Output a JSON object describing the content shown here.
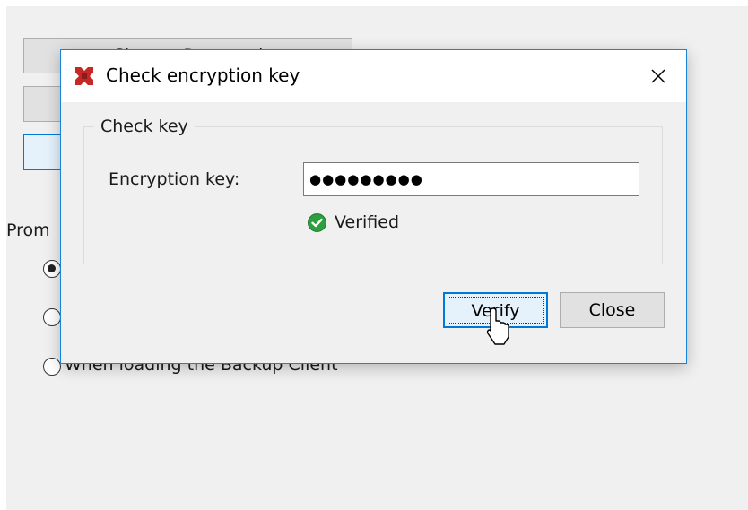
{
  "background": {
    "buttons": [
      "Change Password",
      "",
      ""
    ],
    "prompt_label": "Prom",
    "radio_options": [
      "",
      "",
      "When loading the Backup Client"
    ]
  },
  "dialog": {
    "title": "Check encryption key",
    "app_icon": "app-logo-icon",
    "close_icon": "close-icon",
    "group": {
      "legend": "Check key",
      "field_label": "Encryption key:",
      "field_value": "●●●●●●●●●",
      "status_icon": "check-circle-icon",
      "status_text": "Verified"
    },
    "buttons": {
      "verify": "Verify",
      "close": "Close"
    }
  },
  "colors": {
    "accent": "#0078d7",
    "app_icon": "#c62828",
    "success": "#2e9e3f"
  }
}
